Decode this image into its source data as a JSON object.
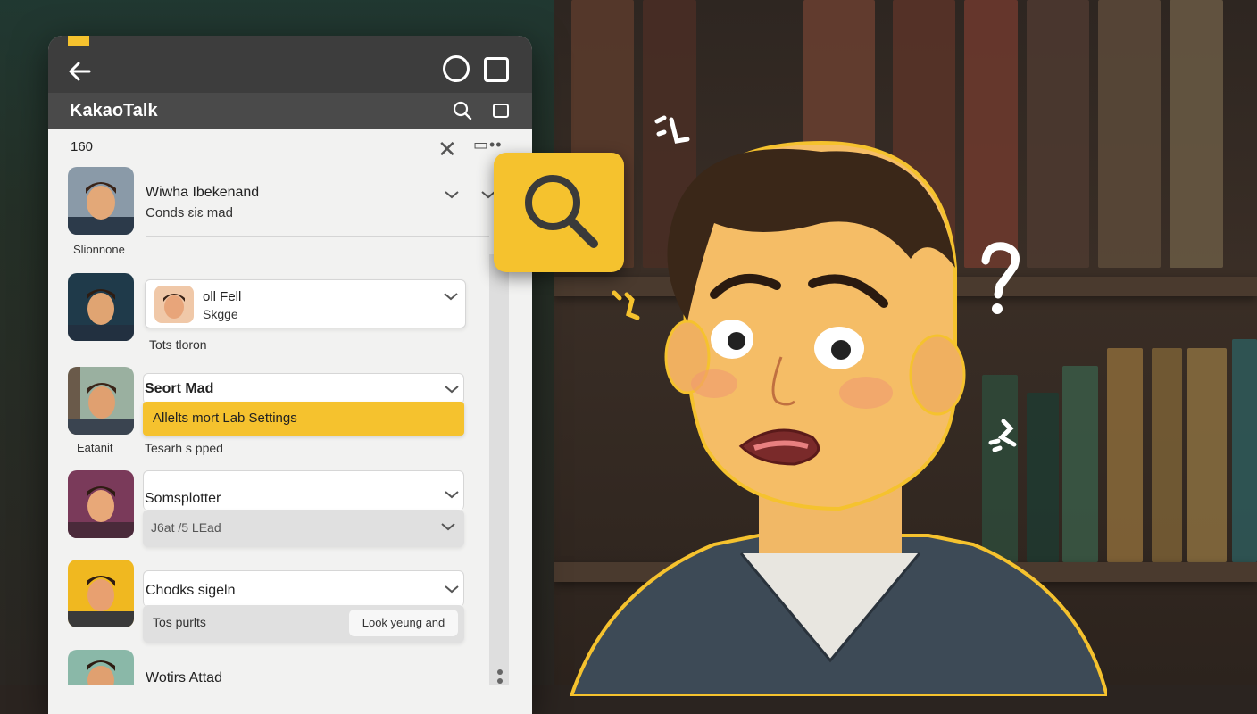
{
  "app": {
    "title": "KakaoTalk",
    "list_count": "160"
  },
  "contacts": [
    {
      "name": "Wiwha Ibekenand",
      "subtitle": "Conds ɛiɛ mad",
      "caption": "Slionnone"
    },
    {
      "name": "oll Fell",
      "subtitle": "Skgge",
      "caption": "Tots tloron"
    },
    {
      "name": "Seort Mad",
      "banner": "Allelts mort Lab Settings",
      "subtitle": "Tesarh s pped",
      "caption": "Eatanit"
    },
    {
      "name": "Somsplotter",
      "field_value": "J6at /5 LEad"
    },
    {
      "name": "Chodks sigeln",
      "subtitle": "Tos purlts",
      "action_label": "Look yeung and"
    },
    {
      "name": "Wotirs Attad"
    }
  ],
  "colors": {
    "accent": "#f5c22e",
    "statusbar": "#3d3d3d",
    "appbar": "#4a4a4a",
    "panel": "#f2f2f1"
  },
  "icons": [
    "back-arrow-icon",
    "circle-icon",
    "square-icon",
    "search-icon",
    "compose-icon",
    "close-icon",
    "more-icon",
    "chevron-down-icon",
    "magnifier-icon"
  ]
}
